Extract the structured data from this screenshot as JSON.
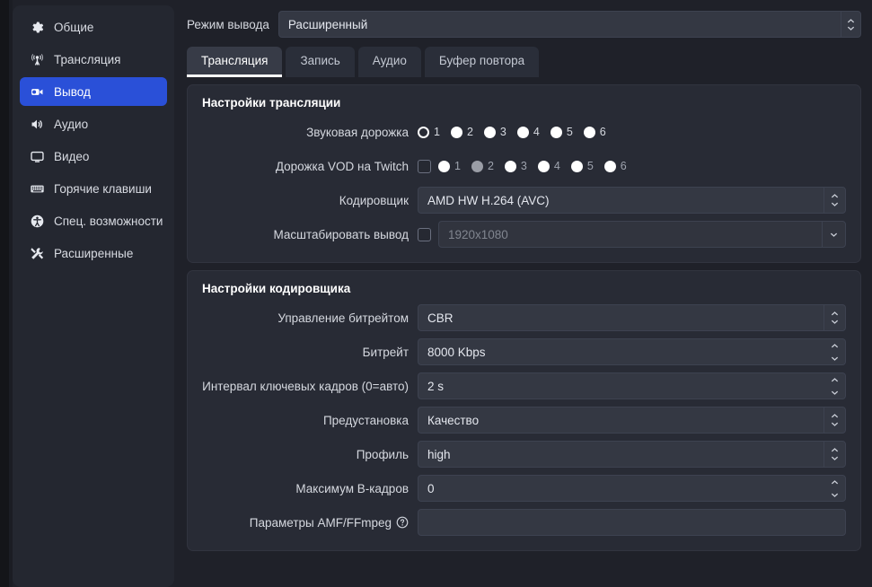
{
  "sidebar": {
    "items": [
      {
        "label": "Общие",
        "icon": "gear-icon",
        "active": false
      },
      {
        "label": "Трансляция",
        "icon": "broadcast-icon",
        "active": false
      },
      {
        "label": "Вывод",
        "icon": "output-camera-icon",
        "active": true
      },
      {
        "label": "Аудио",
        "icon": "speaker-icon",
        "active": false
      },
      {
        "label": "Видео",
        "icon": "monitor-icon",
        "active": false
      },
      {
        "label": "Горячие клавиши",
        "icon": "keyboard-icon",
        "active": false
      },
      {
        "label": "Спец. возможности",
        "icon": "accessibility-icon",
        "active": false
      },
      {
        "label": "Расширенные",
        "icon": "tools-icon",
        "active": false
      }
    ]
  },
  "output_mode": {
    "label": "Режим вывода",
    "value": "Расширенный"
  },
  "tabs": [
    {
      "label": "Трансляция",
      "active": true
    },
    {
      "label": "Запись",
      "active": false
    },
    {
      "label": "Аудио",
      "active": false
    },
    {
      "label": "Буфер повтора",
      "active": false
    }
  ],
  "stream_settings": {
    "title": "Настройки трансляции",
    "audio_track": {
      "label": "Звуковая дорожка",
      "options": [
        "1",
        "2",
        "3",
        "4",
        "5",
        "6"
      ],
      "selected": "1"
    },
    "twitch_vod_track": {
      "label": "Дорожка VOD на Twitch",
      "checked": false,
      "options": [
        "1",
        "2",
        "3",
        "4",
        "5",
        "6"
      ],
      "selected": "2"
    },
    "encoder": {
      "label": "Кодировщик",
      "value": "AMD HW H.264 (AVC)"
    },
    "rescale_output": {
      "label": "Масштабировать вывод",
      "checked": false,
      "value": "1920x1080",
      "enabled": false
    }
  },
  "encoder_settings": {
    "title": "Настройки кодировщика",
    "rows": [
      {
        "label": "Управление битрейтом",
        "value": "CBR",
        "control": "combo"
      },
      {
        "label": "Битрейт",
        "value": "8000 Kbps",
        "control": "spin"
      },
      {
        "label": "Интервал ключевых кадров (0=авто)",
        "value": "2 s",
        "control": "spin"
      },
      {
        "label": "Предустановка",
        "value": "Качество",
        "control": "combo"
      },
      {
        "label": "Профиль",
        "value": "high",
        "control": "combo"
      },
      {
        "label": "Максимум B-кадров",
        "value": "0",
        "control": "spin"
      },
      {
        "label": "Параметры AMF/FFmpeg",
        "value": "",
        "control": "text",
        "help": true
      }
    ]
  },
  "colors": {
    "accent": "#2a50d8",
    "panel": "#282b35",
    "background": "#1f2129",
    "sidebar": "#242730",
    "field": "#343843"
  }
}
